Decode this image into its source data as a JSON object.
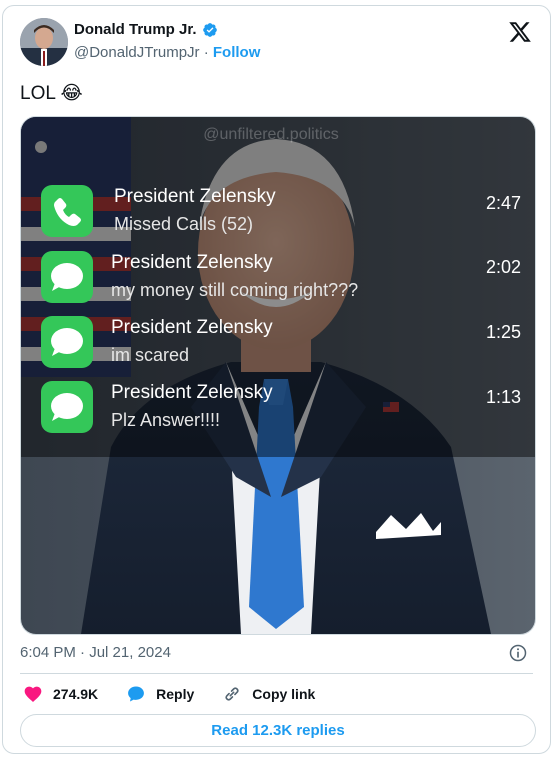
{
  "author": {
    "name": "Donald Trump Jr.",
    "handle": "@DonaldJTrumpJr",
    "separator": "·",
    "follow_label": "Follow"
  },
  "tweet": {
    "text": "LOL",
    "emoji": "😂"
  },
  "media": {
    "watermark": "@unfiltered.politics",
    "notifications": [
      {
        "icon": "phone-icon",
        "title": "President Zelensky",
        "body": "Missed Calls (52)",
        "time": "2:47"
      },
      {
        "icon": "message-icon",
        "title": "President Zelensky",
        "body": "my money still coming right???",
        "time": "2:02"
      },
      {
        "icon": "message-icon",
        "title": "President Zelensky",
        "body": "im scared",
        "time": "1:25"
      },
      {
        "icon": "message-icon",
        "title": "President Zelensky",
        "body": "Plz Answer!!!!",
        "time": "1:13"
      }
    ]
  },
  "meta": {
    "time": "6:04 PM",
    "separator": "·",
    "date": "Jul 21, 2024"
  },
  "actions": {
    "likes": "274.9K",
    "reply_label": "Reply",
    "copy_link_label": "Copy link"
  },
  "read_replies_label": "Read 12.3K replies",
  "colors": {
    "accent": "#1d9bf0",
    "like": "#f91880",
    "ios_green": "#34c759"
  }
}
